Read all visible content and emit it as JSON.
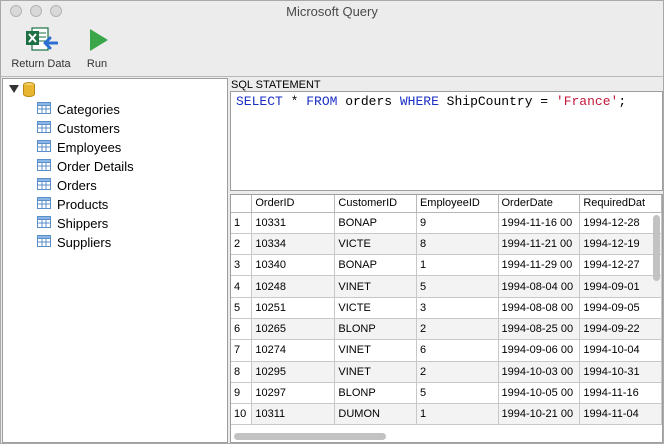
{
  "window": {
    "title": "Microsoft Query"
  },
  "toolbar": {
    "return_label": "Return Data",
    "run_label": "Run"
  },
  "tree": {
    "items": [
      "Categories",
      "Customers",
      "Employees",
      "Order Details",
      "Orders",
      "Products",
      "Shippers",
      "Suppliers"
    ]
  },
  "sql": {
    "label": "SQL STATEMENT",
    "tokens": {
      "select": "SELECT",
      "star": " * ",
      "from": "FROM",
      "table": " orders ",
      "where": "WHERE",
      "cond": " ShipCountry = ",
      "value": "'France'",
      "end": ";"
    }
  },
  "grid": {
    "headers": [
      "",
      "OrderID",
      "CustomerID",
      "EmployeeID",
      "OrderDate",
      "RequiredDat"
    ],
    "rows": [
      [
        "1",
        "10331",
        "BONAP",
        "9",
        "1994-11-16 00",
        "1994-12-28"
      ],
      [
        "2",
        "10334",
        "VICTE",
        "8",
        "1994-11-21 00",
        "1994-12-19"
      ],
      [
        "3",
        "10340",
        "BONAP",
        "1",
        "1994-11-29 00",
        "1994-12-27"
      ],
      [
        "4",
        "10248",
        "VINET",
        "5",
        "1994-08-04 00",
        "1994-09-01"
      ],
      [
        "5",
        "10251",
        "VICTE",
        "3",
        "1994-08-08 00",
        "1994-09-05"
      ],
      [
        "6",
        "10265",
        "BLONP",
        "2",
        "1994-08-25 00",
        "1994-09-22"
      ],
      [
        "7",
        "10274",
        "VINET",
        "6",
        "1994-09-06 00",
        "1994-10-04"
      ],
      [
        "8",
        "10295",
        "VINET",
        "2",
        "1994-10-03 00",
        "1994-10-31"
      ],
      [
        "9",
        "10297",
        "BLONP",
        "5",
        "1994-10-05 00",
        "1994-11-16"
      ],
      [
        "10",
        "10311",
        "DUMON",
        "1",
        "1994-10-21 00",
        "1994-11-04"
      ]
    ]
  },
  "colors": {
    "keyword": "#1a2fc4",
    "string": "#c3173b",
    "excel_green": "#1d7044",
    "run_green": "#3aa64a",
    "db_gold": "#e8b631"
  }
}
